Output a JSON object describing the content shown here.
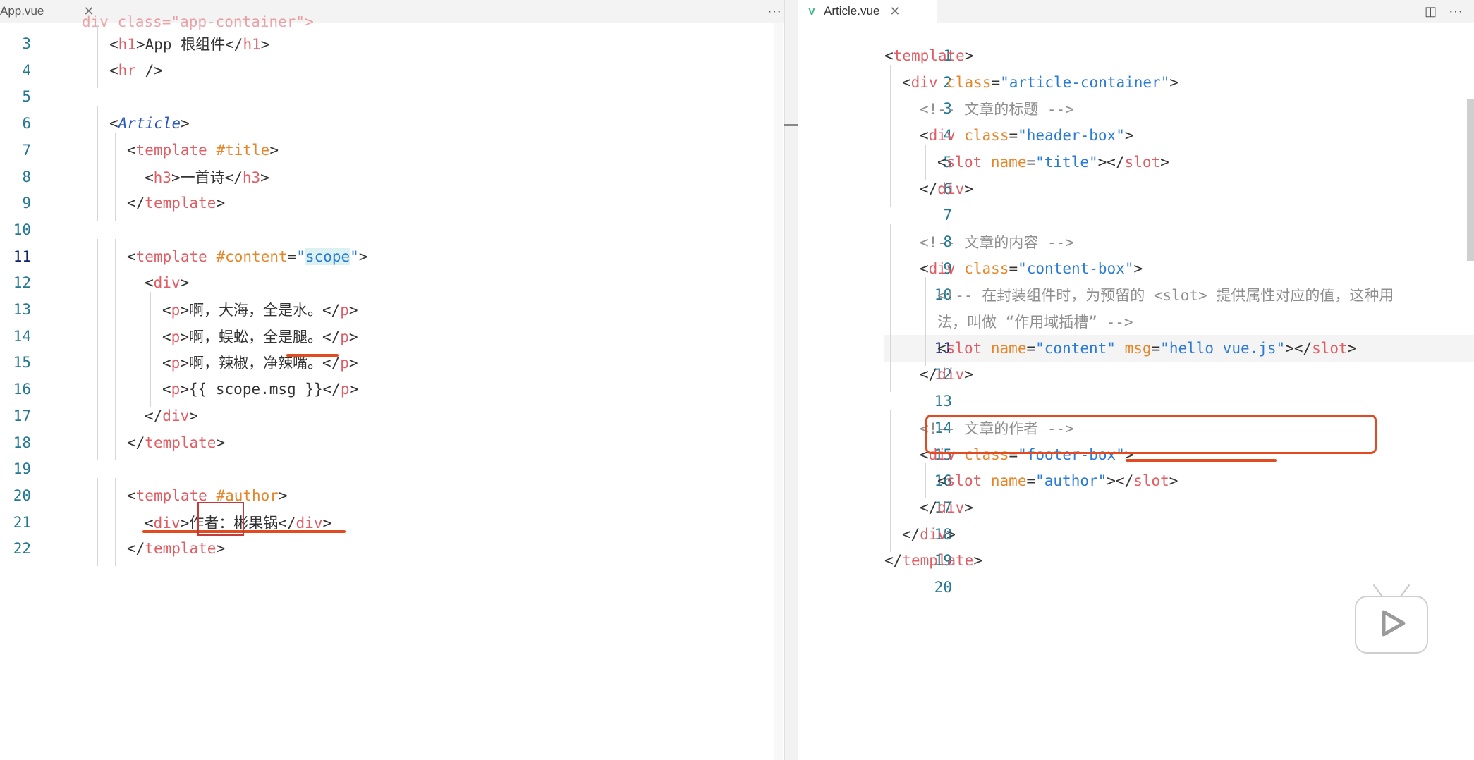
{
  "editor": {
    "left_tab": {
      "label": "App.vue",
      "close": "✕"
    },
    "right_tab": {
      "label": "Article.vue",
      "icon": "V",
      "close": "✕"
    },
    "more": "···",
    "split": "◫"
  },
  "left_code": [
    {
      "n": "3",
      "html": "<span class='p'>&lt;</span><span class='t'>h1</span><span class='p'>&gt;App 根组件&lt;/</span><span class='t'>h1</span><span class='p'>&gt;</span>",
      "indent": 1
    },
    {
      "n": "4",
      "html": "<span class='p'>&lt;</span><span class='t'>hr</span><span class='p'> /&gt;</span>",
      "indent": 1
    },
    {
      "n": "5",
      "html": "",
      "indent": 0
    },
    {
      "n": "6",
      "html": "<span class='p'>&lt;</span><span class='comp'>Article</span><span class='p'>&gt;</span>",
      "indent": 1
    },
    {
      "n": "7",
      "html": "<span class='p'>&lt;</span><span class='t'>template</span> <span class='a'>#title</span><span class='p'>&gt;</span>",
      "indent": 2
    },
    {
      "n": "8",
      "html": "<span class='p'>&lt;</span><span class='t'>h3</span><span class='p'>&gt;一首诗&lt;/</span><span class='t'>h3</span><span class='p'>&gt;</span>",
      "indent": 3
    },
    {
      "n": "9",
      "html": "<span class='p'>&lt;/</span><span class='t'>template</span><span class='p'>&gt;</span>",
      "indent": 2
    },
    {
      "n": "10",
      "html": "",
      "indent": 0
    },
    {
      "n": "11",
      "html": "<span class='p'>&lt;</span><span class='t'>template</span> <span class='a'>#content</span><span class='p'>=</span><span class='s'>\"<span class='hl'>scope</span>\"</span><span class='p'>&gt;</span>",
      "indent": 2
    },
    {
      "n": "12",
      "html": "<span class='p'>&lt;</span><span class='t'>div</span><span class='p'>&gt;</span>",
      "indent": 3
    },
    {
      "n": "13",
      "html": "<span class='p'>&lt;</span><span class='t'>p</span><span class='p'>&gt;啊，大海，全是水。&lt;/</span><span class='t'>p</span><span class='p'>&gt;</span>",
      "indent": 4
    },
    {
      "n": "14",
      "html": "<span class='p'>&lt;</span><span class='t'>p</span><span class='p'>&gt;啊，蜈蚣，全是腿。&lt;/</span><span class='t'>p</span><span class='p'>&gt;</span>",
      "indent": 4
    },
    {
      "n": "15",
      "html": "<span class='p'>&lt;</span><span class='t'>p</span><span class='p'>&gt;啊，辣椒，净辣嘴。&lt;/</span><span class='t'>p</span><span class='p'>&gt;</span>",
      "indent": 4
    },
    {
      "n": "16",
      "html": "<span class='p'>&lt;</span><span class='t'>p</span><span class='p'>&gt;{{ scope.msg }}&lt;/</span><span class='t'>p</span><span class='p'>&gt;</span>",
      "indent": 4
    },
    {
      "n": "17",
      "html": "<span class='p'>&lt;/</span><span class='t'>div</span><span class='p'>&gt;</span>",
      "indent": 3
    },
    {
      "n": "18",
      "html": "<span class='p'>&lt;/</span><span class='t'>template</span><span class='p'>&gt;</span>",
      "indent": 2
    },
    {
      "n": "19",
      "html": "",
      "indent": 0
    },
    {
      "n": "20",
      "html": "<span class='p'>&lt;</span><span class='t'>template</span> <span class='a'>#author</span><span class='p'>&gt;</span>",
      "indent": 2
    },
    {
      "n": "21",
      "html": "<span class='p'>&lt;</span><span class='t'>div</span><span class='p'>&gt;作者：彬果锅&lt;/</span><span class='t'>div</span><span class='p'>&gt;</span>",
      "indent": 3
    },
    {
      "n": "22",
      "html": "<span class='p'>&lt;/</span><span class='t'>template</span><span class='p'>&gt;</span>",
      "indent": 2
    }
  ],
  "left_top_partial": "div class=\"app-container\">",
  "right_code": [
    {
      "n": "1",
      "html": "<span class='p'>&lt;</span><span class='t'>template</span><span class='p'>&gt;</span>",
      "indent": 0
    },
    {
      "n": "2",
      "html": "<span class='p'>&lt;</span><span class='t'>div</span> <span class='a'>class</span><span class='p'>=</span><span class='s'>\"article-container\"</span><span class='p'>&gt;</span>",
      "indent": 1
    },
    {
      "n": "3",
      "html": "<span class='c'>&lt;!-- 文章的标题 --&gt;</span>",
      "indent": 2
    },
    {
      "n": "4",
      "html": "<span class='p'>&lt;</span><span class='t'>div</span> <span class='a'>class</span><span class='p'>=</span><span class='s'>\"header-box\"</span><span class='p'>&gt;</span>",
      "indent": 2
    },
    {
      "n": "5",
      "html": "<span class='p'>&lt;</span><span class='t'>slot</span> <span class='a'>name</span><span class='p'>=</span><span class='s'>\"title\"</span><span class='p'>&gt;&lt;/</span><span class='t'>slot</span><span class='p'>&gt;</span>",
      "indent": 3
    },
    {
      "n": "6",
      "html": "<span class='p'>&lt;/</span><span class='t'>div</span><span class='p'>&gt;</span>",
      "indent": 2
    },
    {
      "n": "7",
      "html": "",
      "indent": 0
    },
    {
      "n": "8",
      "html": "<span class='c'>&lt;!-- 文章的内容 --&gt;</span>",
      "indent": 2
    },
    {
      "n": "9",
      "html": "<span class='p'>&lt;</span><span class='t'>div</span> <span class='a'>class</span><span class='p'>=</span><span class='s'>\"content-box\"</span><span class='p'>&gt;</span>",
      "indent": 2
    },
    {
      "n": "10",
      "html": "<span class='c'>&lt;!-- 在封装组件时，为预留的 &lt;slot&gt; 提供属性对应的值，这种用</span>",
      "indent": 3
    },
    {
      "n": "",
      "html": "<span class='c'>法，叫做 “作用域插槽” --&gt;</span>",
      "indent": 3
    },
    {
      "n": "11",
      "html": "<span class='p'>&lt;</span><span class='t'>slot</span> <span class='a'>name</span><span class='p'>=</span><span class='s'>\"content\"</span> <span class='a'>msg</span><span class='p'>=</span><span class='s'>\"hello vue.js\"</span><span class='p'>&gt;&lt;/</span><span class='t'>slot</span><span class='p'>&gt;</span>",
      "indent": 3
    },
    {
      "n": "12",
      "html": "<span class='p'>&lt;/</span><span class='t'>div</span><span class='p'>&gt;</span>",
      "indent": 2
    },
    {
      "n": "13",
      "html": "",
      "indent": 0
    },
    {
      "n": "14",
      "html": "<span class='c'>&lt;!-- 文章的作者 --&gt;</span>",
      "indent": 2
    },
    {
      "n": "15",
      "html": "<span class='p'>&lt;</span><span class='t'>div</span> <span class='a'>class</span><span class='p'>=</span><span class='s'>\"footer-box\"</span><span class='p'>&gt;</span>",
      "indent": 2
    },
    {
      "n": "16",
      "html": "<span class='p'>&lt;</span><span class='t'>slot</span> <span class='a'>name</span><span class='p'>=</span><span class='s'>\"author\"</span><span class='p'>&gt;&lt;/</span><span class='t'>slot</span><span class='p'>&gt;</span>",
      "indent": 3
    },
    {
      "n": "17",
      "html": "<span class='p'>&lt;/</span><span class='t'>div</span><span class='p'>&gt;</span>",
      "indent": 2
    },
    {
      "n": "18",
      "html": "<span class='p'>&lt;/</span><span class='t'>div</span><span class='p'>&gt;</span>",
      "indent": 1
    },
    {
      "n": "19",
      "html": "<span class='p'>&lt;/</span><span class='t'>template</span><span class='p'>&gt;</span>",
      "indent": 0
    },
    {
      "n": "20",
      "html": "",
      "indent": 0
    }
  ],
  "colors": {
    "annotation": "#e24a22",
    "tag": "#e05d63",
    "attr": "#e5862b",
    "string": "#2b7bd4",
    "comment": "#8f8f8f"
  },
  "icons": {
    "play": "play-icon",
    "vue": "vue-icon"
  }
}
